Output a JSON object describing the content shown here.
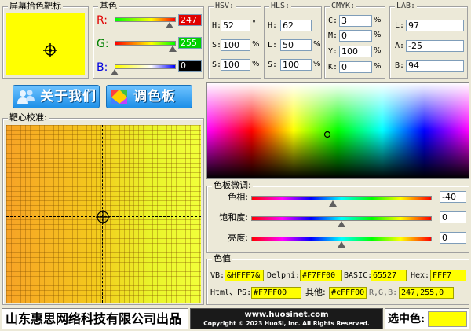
{
  "screen_picker": {
    "label": "屏幕拾色靶标",
    "color": "#ffff00"
  },
  "base": {
    "label": "基色",
    "r": {
      "letter": "R:",
      "value": "247",
      "fraction": 0.969
    },
    "g": {
      "letter": "G:",
      "value": "255",
      "fraction": 1.0
    },
    "b": {
      "letter": "B:",
      "value": "0",
      "fraction": 0.0
    }
  },
  "hsv": {
    "label": "HSV:",
    "h_label": "H:",
    "h": "52",
    "h_unit": "°",
    "s_label": "S:",
    "s": "100",
    "s_unit": "%",
    "v_label": "S:",
    "v": "100",
    "v_unit": "%"
  },
  "hls": {
    "label": "HLS:",
    "h_label": "H:",
    "h": "62",
    "l_label": "L:",
    "l": "50",
    "l_unit": "%",
    "s_label": "S:",
    "s": "100",
    "s_unit": "%"
  },
  "cmyk": {
    "label": "CMYK:",
    "c_label": "C:",
    "c": "3",
    "m_label": "M:",
    "m": "0",
    "y_label": "Y:",
    "y": "100",
    "k_label": "K:",
    "k": "0",
    "unit": "%"
  },
  "lab": {
    "label": "LAB:",
    "l_label": "L:",
    "l": "97",
    "a_label": "A:",
    "a": "-25",
    "b_label": "B:",
    "b": "94"
  },
  "buttons": {
    "about": "关于我们",
    "palette": "调色板"
  },
  "target": {
    "label": "靶心校准:"
  },
  "fine_tune": {
    "label": "色板微调:",
    "hue": {
      "label": "色相:",
      "value": "-40",
      "fraction": 0.44
    },
    "saturation": {
      "label": "饱和度:",
      "value": "0",
      "fraction": 0.5
    },
    "brightness": {
      "label": "亮度:",
      "value": "0",
      "fraction": 0.5
    }
  },
  "values": {
    "label": "色值",
    "vb_label": "VB:",
    "vb": "&HFFF7&",
    "delphi_label": "Delphi:",
    "delphi": "#F7FF00",
    "basic_label": "BASIC:",
    "basic": "65527",
    "hex_label": "Hex:",
    "hex": "FFF7",
    "html_label": "Html、PS:",
    "html": "#F7FF00",
    "other_label": "其他:",
    "other": "#cFFF00",
    "rgb_label": "R,G,B:",
    "rgb": "247,255,0"
  },
  "footer": {
    "company": "山东惠思网络科技有限公司出品",
    "website": "www.huosinet.com",
    "copyright": "Copyright © 2023 HuoSi, Inc. All Rights Reserved.",
    "selected_label": "选中色:",
    "selected_color": "#ffff00"
  }
}
